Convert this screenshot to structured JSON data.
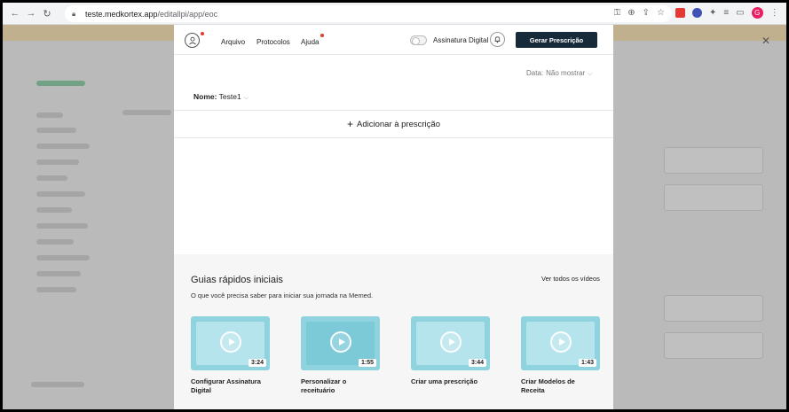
{
  "browser": {
    "url_host": "teste.medkortex.app",
    "url_path": "/editallpi/app/eoc",
    "profile_initial": "G"
  },
  "modal": {
    "menu": [
      "Arquivo",
      "Protocolos",
      "Ajuda"
    ],
    "toggle_label": "Assinatura Digital",
    "generate_button": "Gerar Prescrição",
    "date_label": "Data:",
    "date_value": "Não mostrar",
    "name_label": "Nome:",
    "name_value": "Teste1",
    "add_label": "Adicionar à prescrição",
    "guides": {
      "title": "Guias rápidos iniciais",
      "subtitle": "O que você precisa saber para iniciar sua jornada na Memed.",
      "see_all": "Ver todos os vídeos",
      "videos": [
        {
          "duration": "3:24",
          "label": "Configurar Assinatura Digital"
        },
        {
          "duration": "1:55",
          "label": "Personalizar o receituário"
        },
        {
          "duration": "3:44",
          "label": "Criar uma prescrição"
        },
        {
          "duration": "1:43",
          "label": "Criar Modelos de Receita"
        }
      ]
    }
  },
  "colors": {
    "primary_button": "#172a3a",
    "thumb": "#8fd3df",
    "notify_dot": "#e53935"
  }
}
